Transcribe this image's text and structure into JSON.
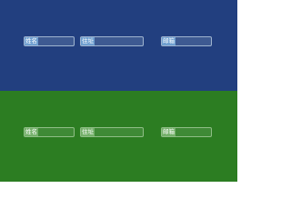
{
  "top_panel": {
    "background": "#223f7f",
    "fields": [
      {
        "label": "姓名",
        "value": ""
      },
      {
        "label": "住址",
        "value": ""
      },
      {
        "label": "邮箱",
        "value": ""
      }
    ]
  },
  "bottom_panel": {
    "background": "#2c7d22",
    "fields": [
      {
        "label": "姓名",
        "value": ""
      },
      {
        "label": "住址",
        "value": ""
      },
      {
        "label": "邮箱",
        "value": ""
      }
    ]
  }
}
